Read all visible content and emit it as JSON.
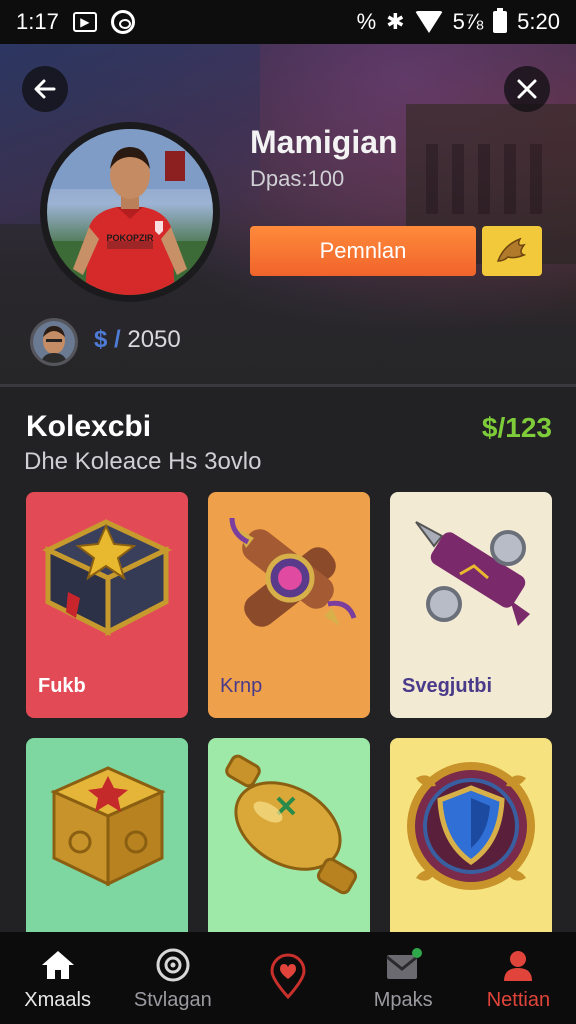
{
  "status_bar": {
    "time_left": "1:17",
    "network_label": "%",
    "battery_label": "5⅞",
    "time_right": "5:20"
  },
  "profile": {
    "name": "Mamigian",
    "subtitle": "Dpas:100",
    "action_label": "Pemnlan",
    "balance": "2050",
    "balance_currency": "$ /",
    "jersey_text": "POKOPZIR"
  },
  "collection": {
    "title": "Kolexcbi",
    "price": "$/123",
    "subtitle": "Dhe Koleace Hs 3ovlo",
    "items": [
      {
        "label": "Fukb",
        "bg": "#e24a56",
        "icon": "treasure-chest-icon"
      },
      {
        "label": "Krnp",
        "bg": "#eea04a",
        "icon": "scroll-gem-icon"
      },
      {
        "label": "Svegjutbi",
        "bg": "#f2ead2",
        "icon": "rocket-icon"
      },
      {
        "label": "",
        "bg": "#7ed7a0",
        "icon": "gold-cube-icon"
      },
      {
        "label": "",
        "bg": "#9ee8a8",
        "icon": "gold-vase-icon"
      },
      {
        "label": "",
        "bg": "#f6e380",
        "icon": "shield-emblem-icon"
      }
    ]
  },
  "nav": [
    {
      "label": "Xmaals",
      "icon": "home-icon",
      "state": "default"
    },
    {
      "label": "Stvlagan",
      "icon": "ball-icon",
      "state": "muted"
    },
    {
      "label": "",
      "icon": "heart-pin-icon",
      "state": "active"
    },
    {
      "label": "Mpaks",
      "icon": "mail-icon",
      "state": "muted"
    },
    {
      "label": "Nettian",
      "icon": "profile-icon",
      "state": "active"
    }
  ]
}
